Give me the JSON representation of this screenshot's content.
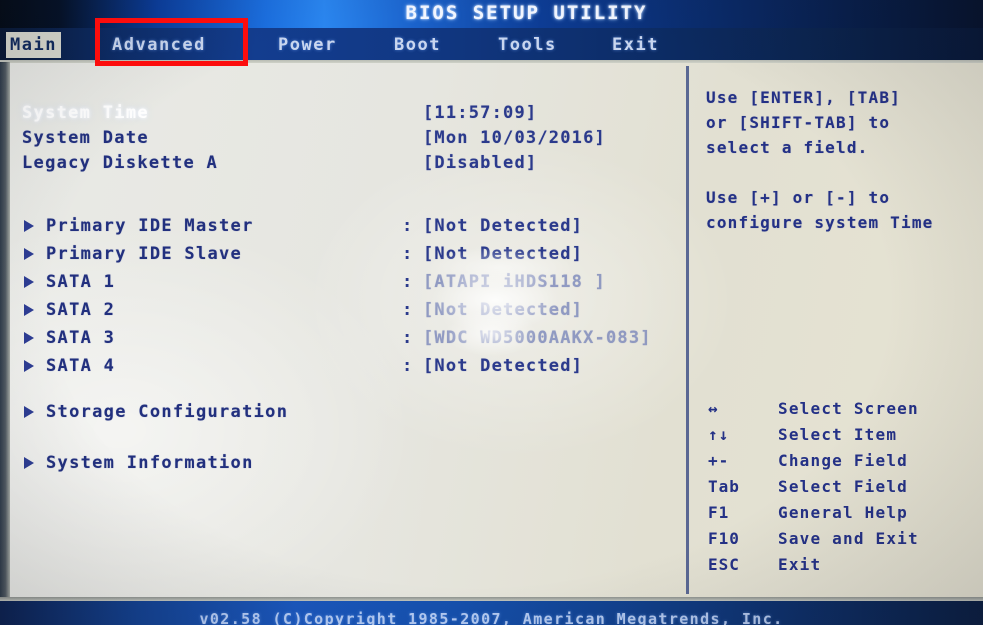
{
  "header": {
    "title": "BIOS SETUP UTILITY"
  },
  "menu": {
    "tabs": [
      {
        "label": "Main",
        "selected": true
      },
      {
        "label": "Advanced",
        "selected": false
      },
      {
        "label": "Power",
        "selected": false
      },
      {
        "label": "Boot",
        "selected": false
      },
      {
        "label": "Tools",
        "selected": false
      },
      {
        "label": "Exit",
        "selected": false
      }
    ]
  },
  "main": {
    "fields": [
      {
        "label": "System Time",
        "value": "[11:57:09]",
        "highlight": true,
        "submenu": false,
        "separator": false
      },
      {
        "label": "System Date",
        "value": "[Mon 10/03/2016]",
        "highlight": false,
        "submenu": false,
        "separator": false
      },
      {
        "label": "Legacy Diskette A",
        "value": "[Disabled]",
        "highlight": false,
        "submenu": false,
        "separator": false
      }
    ],
    "drives": [
      {
        "label": "Primary IDE Master",
        "colon": ":",
        "value": "[Not Detected]",
        "faded": false
      },
      {
        "label": "Primary IDE Slave",
        "colon": ":",
        "value": "[Not Detected]",
        "faded": false
      },
      {
        "label": "SATA 1",
        "colon": ":",
        "value": "[ATAPI    iHDS118    ]",
        "faded": true
      },
      {
        "label": "SATA 2",
        "colon": ":",
        "value": "[Not Detected]",
        "faded": true
      },
      {
        "label": "SATA 3",
        "colon": ":",
        "value": "[WDC WD5000AAKX-083]",
        "faded": true
      },
      {
        "label": "SATA 4",
        "colon": ":",
        "value": "[Not Detected]",
        "faded": false
      }
    ],
    "submenus": [
      {
        "label": "Storage Configuration"
      },
      {
        "label": "System Information"
      }
    ]
  },
  "help": {
    "lines": [
      "Use [ENTER], [TAB]",
      "or [SHIFT-TAB] to",
      "select a field.",
      "",
      "Use [+] or [-] to",
      "configure system Time"
    ],
    "legend": [
      {
        "key": "↔",
        "desc": "Select Screen"
      },
      {
        "key": "↑↓",
        "desc": "Select Item"
      },
      {
        "key": "+-",
        "desc": "Change Field"
      },
      {
        "key": "Tab",
        "desc": "Select Field"
      },
      {
        "key": "F1",
        "desc": "General Help"
      },
      {
        "key": "F10",
        "desc": "Save and Exit"
      },
      {
        "key": "ESC",
        "desc": "Exit"
      }
    ]
  },
  "footer": {
    "text": "v02.58 (C)Copyright 1985-2007, American Megatrends, Inc."
  },
  "annotation": {
    "target_tab": "Advanced",
    "color": "#fc0d0d"
  },
  "colors": {
    "title_bar_blue": "#133d8f",
    "text_blue": "#22307e",
    "highlight_white": "#ffffff",
    "screen_background": "#e6e4d8",
    "annotation_red": "#fc0d0d"
  }
}
